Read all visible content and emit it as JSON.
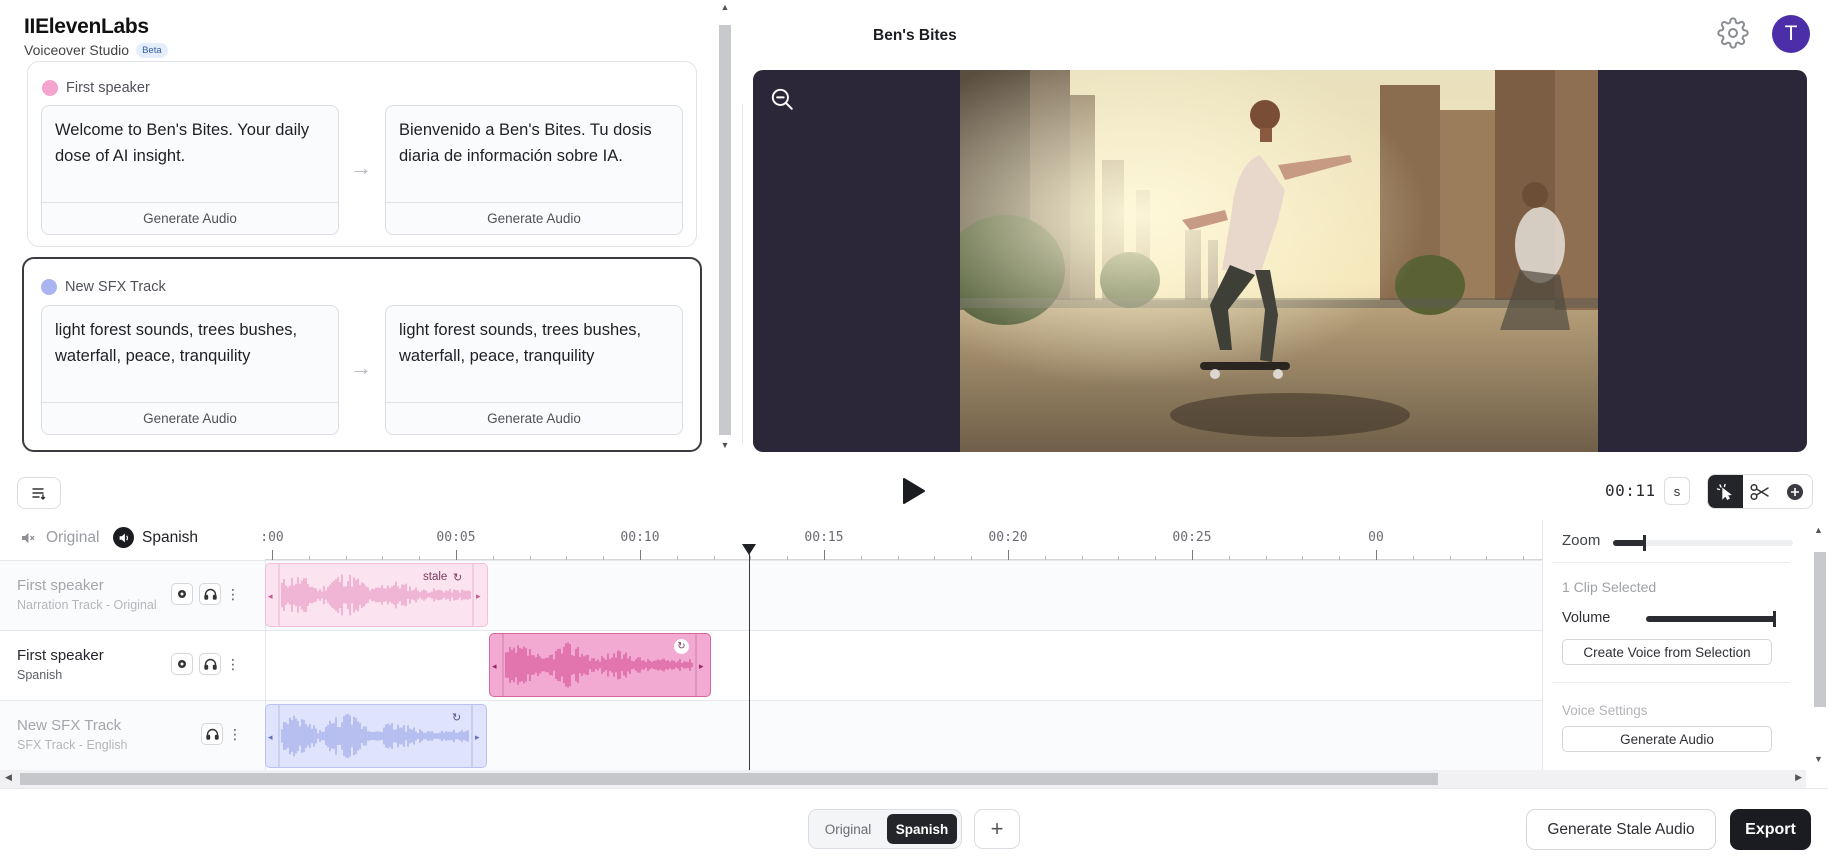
{
  "app": {
    "logo": "IIElevenLabs",
    "product": "Voiceover Studio",
    "badge": "Beta",
    "project_title": "Ben's Bites",
    "user_initial": "T"
  },
  "colors": {
    "accent": "#4c2fa8",
    "speaker_pink": "#f5a3cf",
    "sfx_lavender": "#aab4f0",
    "dark_button": "#1b1c21"
  },
  "segments": [
    {
      "speaker": "First speaker",
      "source_text": "Welcome to Ben's Bites. Your daily dose of AI insight.",
      "target_text": "Bienvenido a Ben's Bites. Tu dosis diaria de información sobre IA.",
      "source_action": "Generate Audio",
      "target_action": "Generate Audio"
    },
    {
      "speaker": "New SFX Track",
      "source_text": "light forest sounds, trees bushes, waterfall, peace, tranquility",
      "target_text": "light forest sounds, trees bushes, waterfall, peace, tranquility",
      "source_action": "Generate Audio",
      "target_action": "Generate Audio"
    }
  ],
  "transport": {
    "timecode": "00:11",
    "unit": "s"
  },
  "languages": {
    "original": "Original",
    "active": "Spanish"
  },
  "ruler": {
    "labels": [
      ":00",
      "00:05",
      "00:10",
      "00:15",
      "00:20",
      "00:25",
      "00"
    ]
  },
  "tracks": [
    {
      "name": "First speaker",
      "subtitle": "Narration Track - Original",
      "clip_tag": "stale"
    },
    {
      "name": "First speaker",
      "subtitle": "Spanish"
    },
    {
      "name": "New SFX Track",
      "subtitle": "SFX Track - English"
    }
  ],
  "inspector": {
    "zoom_label": "Zoom",
    "zoom_level": 0.18,
    "selection": "1 Clip Selected",
    "volume_label": "Volume",
    "volume_level": 1.0,
    "create_voice": "Create Voice from Selection",
    "voice_settings": "Voice Settings",
    "generate_audio": "Generate Audio"
  },
  "footer": {
    "lang_original": "Original",
    "lang_spanish": "Spanish",
    "add": "+",
    "generate_stale": "Generate Stale Audio",
    "export": "Export"
  },
  "icons": {
    "settings": "gear-icon",
    "zoom_out": "zoom-out-icon",
    "play": "play-icon",
    "list": "list-icon",
    "select_tool": "cursor-icon",
    "cut_tool": "scissors-icon",
    "add_tool": "plus-circle-icon",
    "arrow": "arrow-right-icon"
  }
}
